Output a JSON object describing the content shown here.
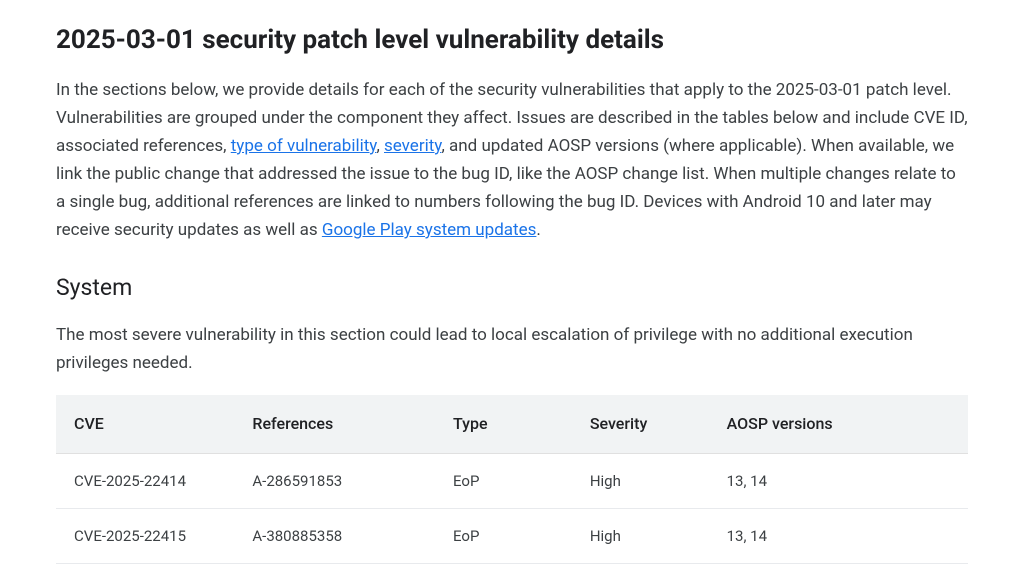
{
  "heading": "2025-03-01 security patch level vulnerability details",
  "intro": {
    "part1": "In the sections below, we provide details for each of the security vulnerabilities that apply to the 2025-03-01 patch level. Vulnerabilities are grouped under the component they affect. Issues are described in the tables below and include CVE ID, associated references, ",
    "link1": "type of vulnerability",
    "part2": ", ",
    "link2": "severity",
    "part3": ", and updated AOSP versions (where applicable). When available, we link the public change that addressed the issue to the bug ID, like the AOSP change list. When multiple changes relate to a single bug, additional references are linked to numbers following the bug ID. Devices with Android 10 and later may receive security updates as well as ",
    "link3": "Google Play system updates",
    "part4": "."
  },
  "section": {
    "title": "System",
    "description": "The most severe vulnerability in this section could lead to local escalation of privilege with no additional execution privileges needed."
  },
  "table": {
    "headers": {
      "cve": "CVE",
      "references": "References",
      "type": "Type",
      "severity": "Severity",
      "aosp": "AOSP versions"
    },
    "rows": [
      {
        "cve": "CVE-2025-22414",
        "references": "A-286591853",
        "type": "EoP",
        "severity": "High",
        "aosp": "13, 14"
      },
      {
        "cve": "CVE-2025-22415",
        "references": "A-380885358",
        "type": "EoP",
        "severity": "High",
        "aosp": "13, 14"
      }
    ]
  }
}
